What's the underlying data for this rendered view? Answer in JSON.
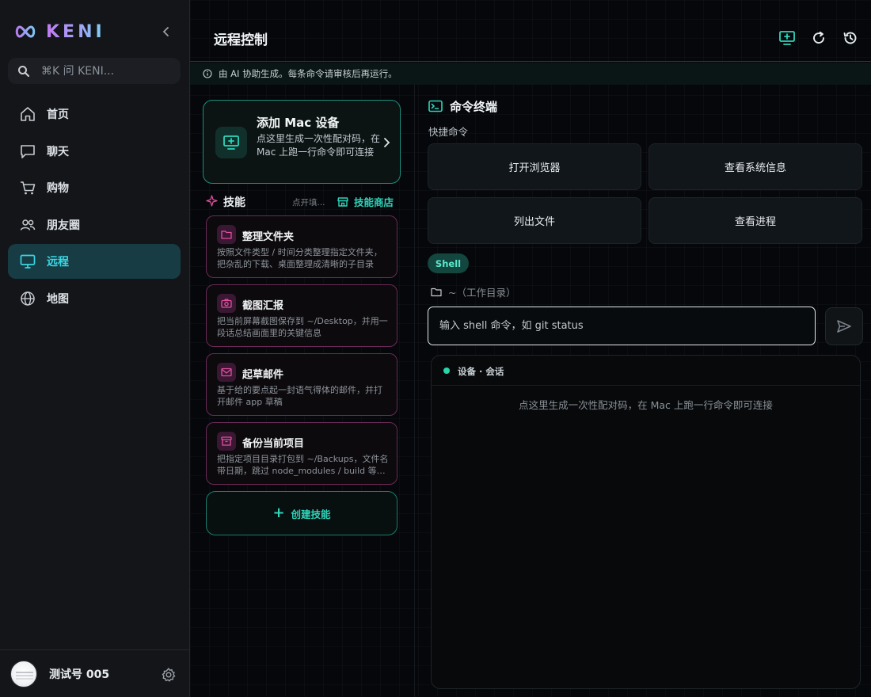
{
  "app": {
    "brand": "KENI"
  },
  "sidebar": {
    "collapse_icon": "chevron-left-icon",
    "search": {
      "placeholder": "⌘K 问 KENI...",
      "icon": "search-icon"
    },
    "items": [
      {
        "label": "首页",
        "icon": "home-icon",
        "active": false
      },
      {
        "label": "聊天",
        "icon": "chat-icon",
        "active": false
      },
      {
        "label": "购物",
        "icon": "cart-icon",
        "active": false
      },
      {
        "label": "朋友圈",
        "icon": "friends-icon",
        "active": false
      },
      {
        "label": "远程",
        "icon": "monitor-icon",
        "active": true
      },
      {
        "label": "地图",
        "icon": "globe-icon",
        "active": false
      }
    ],
    "user": {
      "name": "测试号 005",
      "settings_icon": "gear-icon"
    }
  },
  "header": {
    "title": "远程控制",
    "actions": [
      {
        "icon": "add-screen-icon"
      },
      {
        "icon": "refresh-icon"
      },
      {
        "icon": "history-icon"
      }
    ]
  },
  "notice": {
    "icon": "info-icon",
    "text": "由 AI 协助生成。每条命令请审核后再运行。"
  },
  "add_device": {
    "title": "添加 Mac 设备",
    "description": "点这里生成一次性配对码，在 Mac 上跑一行命令即可连接",
    "icon": "add-screen-icon"
  },
  "skills": {
    "title": "技能",
    "hint": "点开填...",
    "store_label": "技能商店",
    "items": [
      {
        "title": "整理文件夹",
        "icon": "folder-icon",
        "description": "按照文件类型 / 时间分类整理指定文件夹，把杂乱的下载、桌面整理成清晰的子目录"
      },
      {
        "title": "截图汇报",
        "icon": "camera-icon",
        "description": "把当前屏幕截图保存到 ~/Desktop，并用一段话总结画面里的关键信息"
      },
      {
        "title": "起草邮件",
        "icon": "mail-icon",
        "description": "基于给的要点起一封语气得体的邮件，并打开邮件 app 草稿"
      },
      {
        "title": "备份当前项目",
        "icon": "archive-icon",
        "description": "把指定项目目录打包到 ~/Backups，文件名带日期，跳过 node_modules / build 等目录"
      }
    ],
    "create_label": "创建技能"
  },
  "terminal": {
    "title": "命令终端",
    "quick_label": "快捷命令",
    "quick_commands": [
      "打开浏览器",
      "查看系统信息",
      "列出文件",
      "查看进程"
    ],
    "mode": "Shell",
    "cwd": "~（工作目录）",
    "input_placeholder": "输入 shell 命令，如 git status",
    "session_title": "设备 · 会话",
    "session_empty": "点这里生成一次性配对码，在 Mac 上跑一行命令即可连接"
  },
  "colors": {
    "accent": "#2fd5bb",
    "active_nav": "#39d7e4",
    "skill_border": "#6b2a57",
    "skill_icon": "#e0509e"
  }
}
